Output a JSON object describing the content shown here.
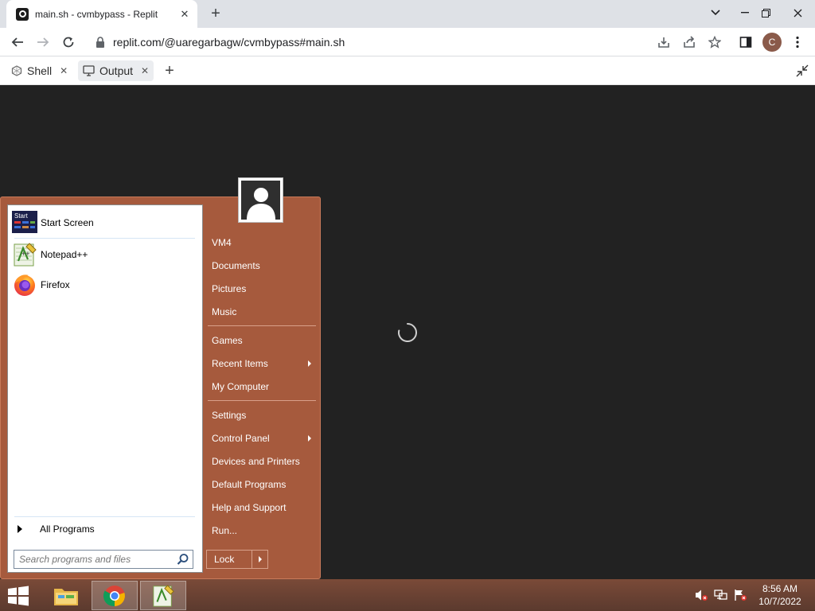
{
  "browser": {
    "tab_title": "main.sh - cvmbypass - Replit",
    "url": "replit.com/@uaregarbagw/cvmbypass#main.sh",
    "profile_initial": "C"
  },
  "replit": {
    "tabs": [
      {
        "label": "Shell"
      },
      {
        "label": "Output"
      }
    ]
  },
  "start_menu": {
    "programs": [
      {
        "label": "Start Screen",
        "icon": "start-screen-icon"
      },
      {
        "label": "Notepad++",
        "icon": "notepad-plus-plus-icon"
      },
      {
        "label": "Firefox",
        "icon": "firefox-icon"
      }
    ],
    "all_programs_label": "All Programs",
    "search_placeholder": "Search programs and files",
    "right_links": [
      {
        "label": "VM4"
      },
      {
        "label": "Documents"
      },
      {
        "label": "Pictures"
      },
      {
        "label": "Music"
      },
      {
        "label": "Games"
      },
      {
        "label": "Recent Items",
        "submenu": true
      },
      {
        "label": "My Computer"
      },
      {
        "label": "Settings"
      },
      {
        "label": "Control Panel",
        "submenu": true
      },
      {
        "label": "Devices and Printers"
      },
      {
        "label": "Default Programs"
      },
      {
        "label": "Help and Support"
      },
      {
        "label": "Run..."
      }
    ],
    "lock_label": "Lock",
    "start_tile_text": "Start"
  },
  "taskbar": {
    "time": "8:56 AM",
    "date": "10/7/2022"
  },
  "colors": {
    "start_menu_bg": "#a65a3d",
    "desktop_bg": "#222222",
    "taskbar": "#6b4032"
  }
}
